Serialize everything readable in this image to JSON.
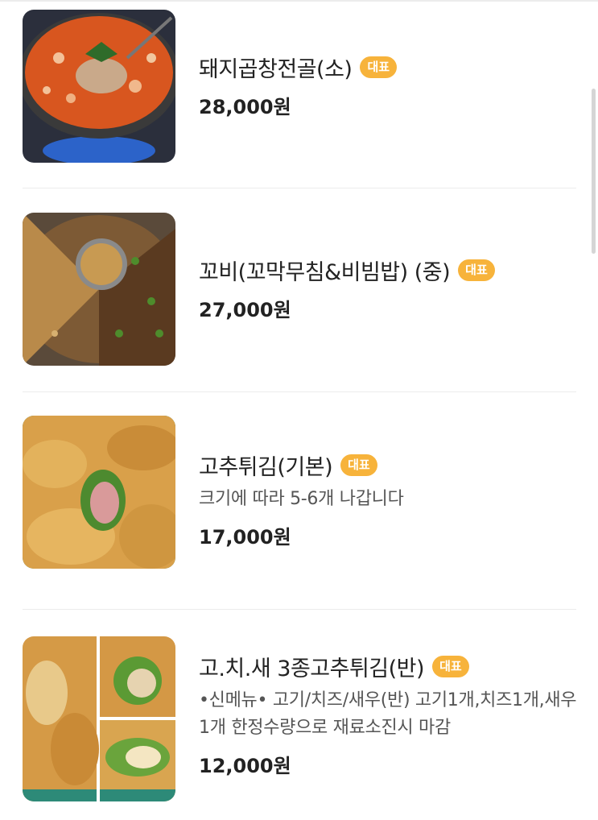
{
  "menu": {
    "items": [
      {
        "name": "돼지곱창전골(소)",
        "badge": "대표",
        "description": "",
        "price": "28,000원",
        "image": "pork-intestine-hotpot-photo"
      },
      {
        "name": "꼬비(꼬막무침&비빔밥) (중)",
        "badge": "대표",
        "description": "",
        "price": "27,000원",
        "image": "cockle-bibimbap-photo"
      },
      {
        "name": "고추튀김(기본)",
        "badge": "대표",
        "description": "크기에 따라 5-6개 나갑니다",
        "price": "17,000원",
        "image": "fried-pepper-photo"
      },
      {
        "name": "고.치.새 3종고추튀김(반)",
        "badge": "대표",
        "description": "•신메뉴• 고기/치즈/새우(반) 고기1개,치즈1개,새우1개 한정수량으로 재료소진시 마감",
        "price": "12,000원",
        "image": "three-kind-fried-pepper-collage"
      }
    ]
  },
  "colors": {
    "badge": "#f7b33b",
    "divider": "#ececec",
    "text": "#222222"
  }
}
